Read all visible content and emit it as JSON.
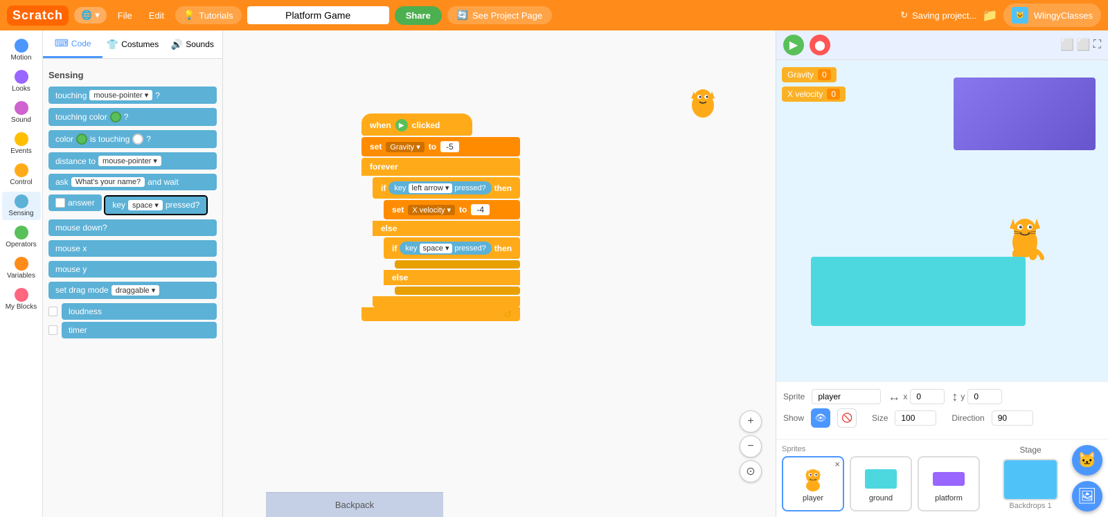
{
  "topnav": {
    "logo": "Scratch",
    "globe_label": "🌐 ▾",
    "file_label": "File",
    "edit_label": "Edit",
    "tutorials_icon": "💡",
    "tutorials_label": "Tutorials",
    "project_name": "Platform Game",
    "share_label": "Share",
    "see_project_icon": "🔄",
    "see_project_label": "See Project Page",
    "saving_label": "Saving project...",
    "folder_icon": "📁",
    "user_avatar": "🐱",
    "user_name": "WlingyClasses"
  },
  "categories": [
    {
      "id": "motion",
      "color": "#4c97ff",
      "label": "Motion"
    },
    {
      "id": "looks",
      "color": "#9966ff",
      "label": "Looks"
    },
    {
      "id": "sound",
      "color": "#cf63cf",
      "label": "Sound"
    },
    {
      "id": "events",
      "color": "#ffbf00",
      "label": "Events"
    },
    {
      "id": "control",
      "color": "#ffab19",
      "label": "Control"
    },
    {
      "id": "sensing",
      "color": "#5cb1d6",
      "label": "Sensing",
      "selected": true
    },
    {
      "id": "operators",
      "color": "#59c059",
      "label": "Operators"
    },
    {
      "id": "variables",
      "color": "#ff8c1a",
      "label": "Variables"
    },
    {
      "id": "myblocks",
      "color": "#ff6680",
      "label": "My Blocks"
    }
  ],
  "blocks_panel": {
    "section": "Sensing",
    "tabs": [
      "Code",
      "Costumes",
      "Sounds"
    ],
    "blocks": [
      {
        "label": "touching mouse-pointer ▾ ?",
        "type": "cyan"
      },
      {
        "label": "touching color ? ",
        "type": "cyan",
        "has_color": true
      },
      {
        "label": "color is touching ?",
        "type": "cyan",
        "has_color2": true
      },
      {
        "label": "distance to mouse-pointer ▾",
        "type": "cyan"
      },
      {
        "label": "ask What's your name? and wait",
        "type": "cyan"
      },
      {
        "label": "answer",
        "type": "cyan",
        "has_checkbox": true
      },
      {
        "label": "key space ▾ pressed?",
        "type": "cyan",
        "selected": true
      },
      {
        "label": "mouse down?",
        "type": "cyan"
      },
      {
        "label": "mouse x",
        "type": "cyan"
      },
      {
        "label": "mouse y",
        "type": "cyan"
      },
      {
        "label": "set drag mode draggable ▾",
        "type": "cyan"
      },
      {
        "label": "loudness",
        "type": "cyan",
        "has_checkbox": true
      },
      {
        "label": "timer",
        "type": "cyan",
        "has_checkbox": true
      }
    ]
  },
  "script": {
    "hat_label": "when 🚩 clicked",
    "blocks": [
      {
        "text": "set Gravity ▾ to -5"
      },
      {
        "text": "forever"
      },
      {
        "text": "if key left arrow ▾ pressed? then",
        "indent": 1
      },
      {
        "text": "set X velocity ▾ to -4",
        "indent": 2
      },
      {
        "text": "else",
        "indent": 1
      },
      {
        "text": "if key space ▾ pressed? then",
        "indent": 2
      },
      {
        "text": "(blank)",
        "indent": 3
      },
      {
        "text": "else",
        "indent": 2
      },
      {
        "text": "(blank)",
        "indent": 3
      }
    ]
  },
  "stage": {
    "variables": [
      {
        "name": "Gravity",
        "value": "0"
      },
      {
        "name": "X velocity",
        "value": "0"
      }
    ],
    "sprites": [
      {
        "name": "player",
        "selected": true,
        "type": "cat"
      },
      {
        "name": "ground",
        "type": "ground"
      },
      {
        "name": "platform",
        "type": "platform"
      }
    ],
    "sprite_info": {
      "label": "Sprite",
      "name": "player",
      "x": "0",
      "y": "0",
      "show": true,
      "size": "100",
      "direction": "90"
    },
    "stage_label": "Stage",
    "backdrops_count": "1"
  },
  "backpack": {
    "label": "Backpack"
  },
  "zoom": {
    "zoom_in": "+",
    "zoom_out": "−",
    "fit": "⊙"
  }
}
